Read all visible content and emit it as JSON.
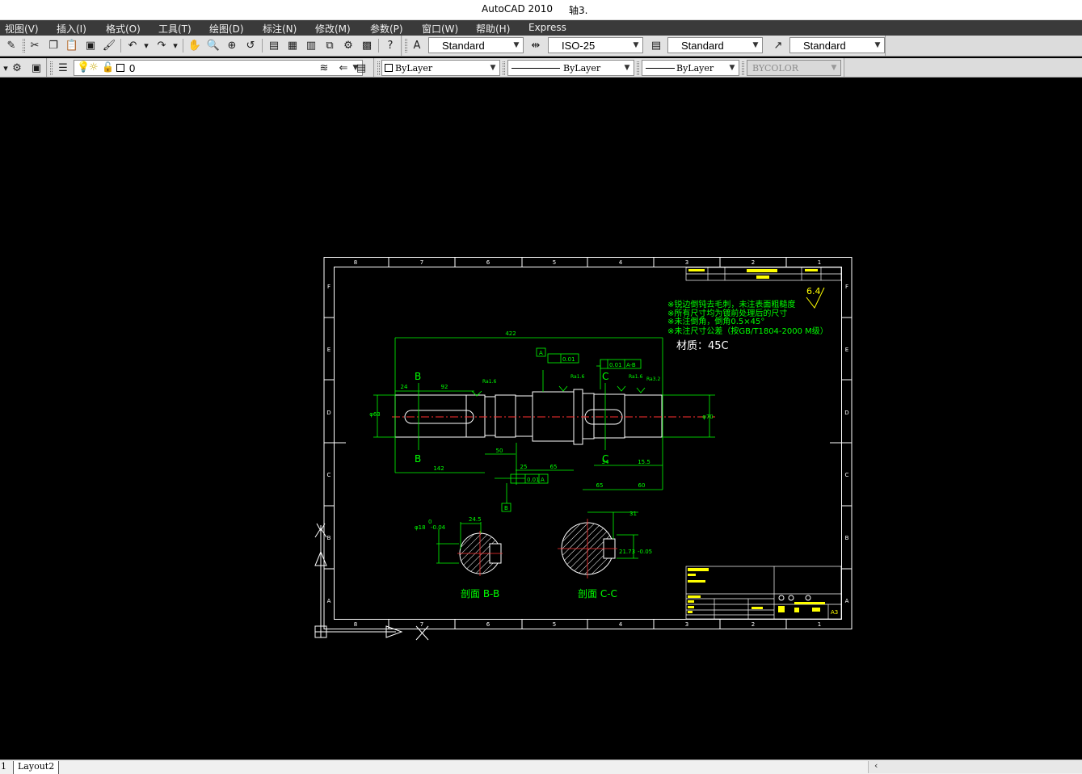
{
  "window": {
    "app_title": "AutoCAD 2010",
    "doc_title": "轴3."
  },
  "menu": [
    "视图(V)",
    "插入(I)",
    "格式(O)",
    "工具(T)",
    "绘图(D)",
    "标注(N)",
    "修改(M)",
    "参数(P)",
    "窗口(W)",
    "帮助(H)",
    "Express"
  ],
  "styles": {
    "text_style": "Standard",
    "dim_style": "ISO-25",
    "table_style": "Standard",
    "mleader_style": "Standard"
  },
  "layers": {
    "current_layer": "0",
    "color": "ByLayer",
    "linetype": "ByLayer",
    "lineweight": "ByLayer",
    "plot_style": "BYCOLOR"
  },
  "tabs": {
    "partial": "1",
    "layout2": "Layout2"
  },
  "drawing": {
    "border_cols": [
      "8",
      "7",
      "6",
      "5",
      "4",
      "3",
      "2",
      "1"
    ],
    "border_rows": [
      "F",
      "E",
      "D",
      "C",
      "B",
      "A"
    ],
    "notes": [
      "※锐边倒钝去毛刺，未注表面粗糙度",
      "※所有尺寸均为镀前处理后的尺寸",
      "※未注倒角，倒角0.5×45°",
      "※未注尺寸公差（按GB/T1804-2000 M级）"
    ],
    "material": "材质：45C",
    "roughness": "6.4",
    "section_bb": "剖面 B-B",
    "section_cc": "剖面 C-C",
    "dims": {
      "overall": "422",
      "d24": "24",
      "d92": "92",
      "d142": "142",
      "d50": "50",
      "d25": "25",
      "d65a": "65",
      "d34": "34",
      "d155": "15.5",
      "d65b": "65",
      "d60": "60",
      "phi63": "φ63",
      "phi70": "φ70",
      "w245": "24.5",
      "w31": "31",
      "w2173": "21.73",
      "phi18": "φ18",
      "phi18tol": "-0.04",
      "c_tol": "-0.05",
      "b_tol": "0"
    },
    "roughness_marks": [
      "Ra1.6",
      "Ra1.6",
      "Ra1.6",
      "Ra3.2"
    ],
    "gdt": [
      "0.01",
      "0.01",
      "A-B",
      "0.01",
      "A"
    ],
    "datums": [
      "A",
      "B"
    ],
    "section_letters": [
      "B",
      "B",
      "C",
      "C"
    ],
    "sheet_no": "A3"
  },
  "colors": {
    "line": "#00ff00",
    "text": "#ffff00",
    "white": "#ffffff",
    "center": "#ff3030",
    "menu_bg": "#3a3a3a"
  }
}
